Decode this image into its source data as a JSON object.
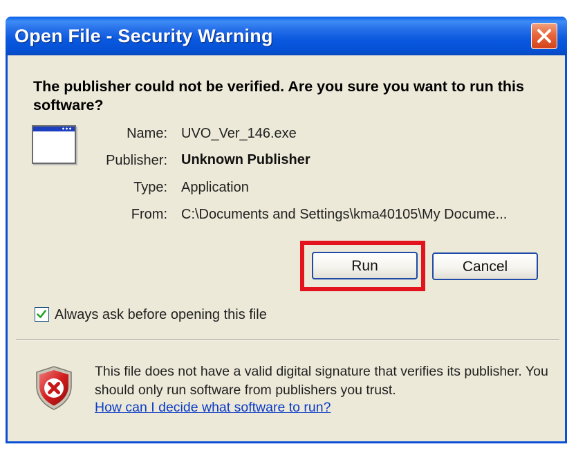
{
  "window": {
    "title": "Open File - Security Warning",
    "close_icon": "close-icon"
  },
  "dialog": {
    "heading": "The publisher could not be verified.  Are you sure you want to run this software?",
    "file_icon": "application-window-icon",
    "fields": [
      {
        "label": "Name:",
        "value": "UVO_Ver_146.exe"
      },
      {
        "label": "Publisher:",
        "value": "Unknown Publisher"
      },
      {
        "label": "Type:",
        "value": "Application"
      },
      {
        "label": "From:",
        "value": "C:\\Documents and Settings\\kma40105\\My Docume..."
      }
    ],
    "buttons": {
      "run": "Run",
      "cancel": "Cancel"
    },
    "always_ask": {
      "label": "Always ask before opening this file",
      "checked": true
    },
    "info": {
      "icon": "security-shield-icon",
      "text": "This file does not have a valid digital signature that verifies its publisher.  You should only run software from publishers you trust.",
      "link": "How can I decide what software to run?"
    }
  },
  "colors": {
    "title_bar": "#0a5fe8",
    "dialog_bg": "#ece9d8",
    "highlight": "#e4141f",
    "link": "#0b3bc7"
  }
}
